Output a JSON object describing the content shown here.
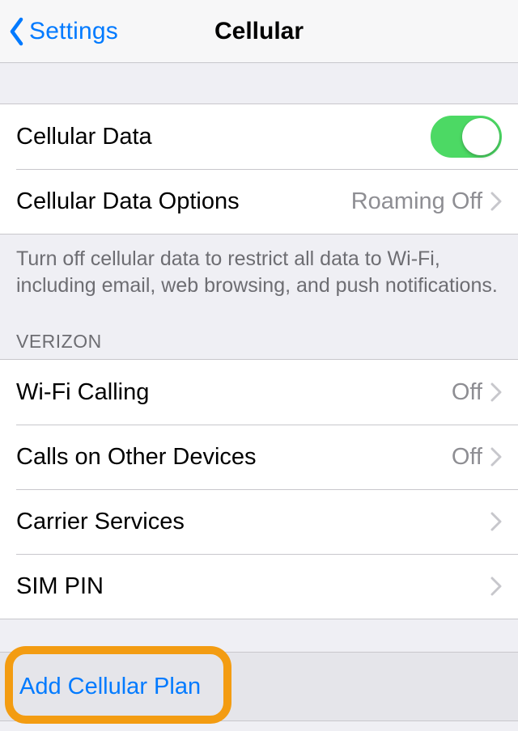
{
  "nav": {
    "back_label": "Settings",
    "title": "Cellular"
  },
  "group1": {
    "cellular_data_label": "Cellular Data",
    "cellular_data_on": true,
    "cellular_data_options_label": "Cellular Data Options",
    "cellular_data_options_value": "Roaming Off"
  },
  "footer_note": "Turn off cellular data to restrict all data to Wi-Fi, including email, web browsing, and push notifications.",
  "section_header": "VERIZON",
  "group2": {
    "wifi_calling_label": "Wi-Fi Calling",
    "wifi_calling_value": "Off",
    "calls_other_label": "Calls on Other Devices",
    "calls_other_value": "Off",
    "carrier_services_label": "Carrier Services",
    "sim_pin_label": "SIM PIN"
  },
  "add_plan_label": "Add Cellular Plan"
}
